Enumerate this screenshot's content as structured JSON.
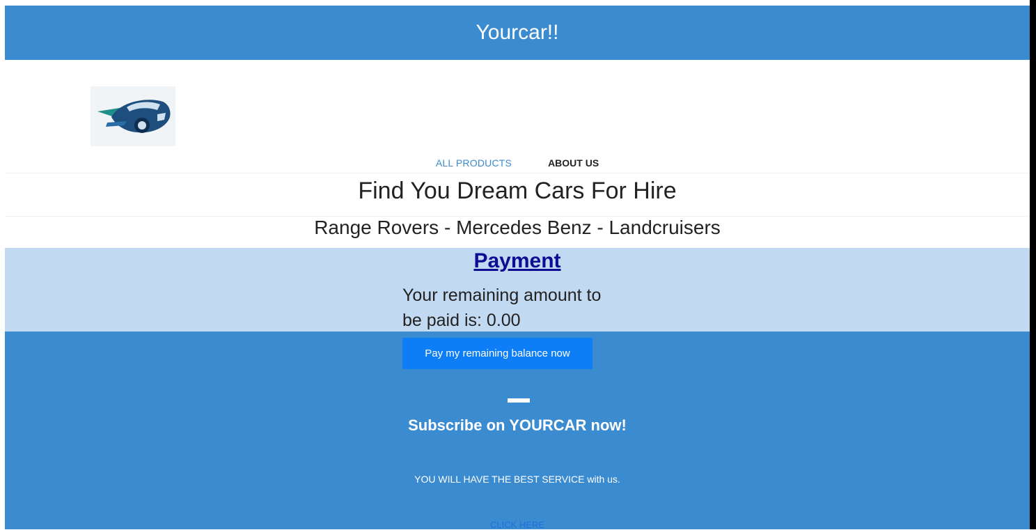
{
  "header": {
    "title": "Yourcar!!"
  },
  "logo": {
    "icon": "car-logo-icon"
  },
  "nav": {
    "all_products": "ALL PRODUCTS",
    "about_us": "ABOUT US"
  },
  "hero": {
    "headline": "Find You Dream Cars For Hire",
    "brands": "Range Rovers - Mercedes Benz - Landcruisers"
  },
  "payment": {
    "title": "Payment",
    "remaining_line1": "Your remaining amount to",
    "remaining_line2": "be paid is: 0.00"
  },
  "footer": {
    "pay_button": "Pay my remaining balance now",
    "subscribe": "Subscribe on YOURCAR now!",
    "service": "YOU WILL HAVE THE BEST SERVICE with us.",
    "link": "CLICK HERE"
  },
  "colors": {
    "primary": "#3b8bd0",
    "payment_band": "#c2d9f2",
    "button": "#0d7ef5",
    "payment_title": "#0d0d94"
  }
}
